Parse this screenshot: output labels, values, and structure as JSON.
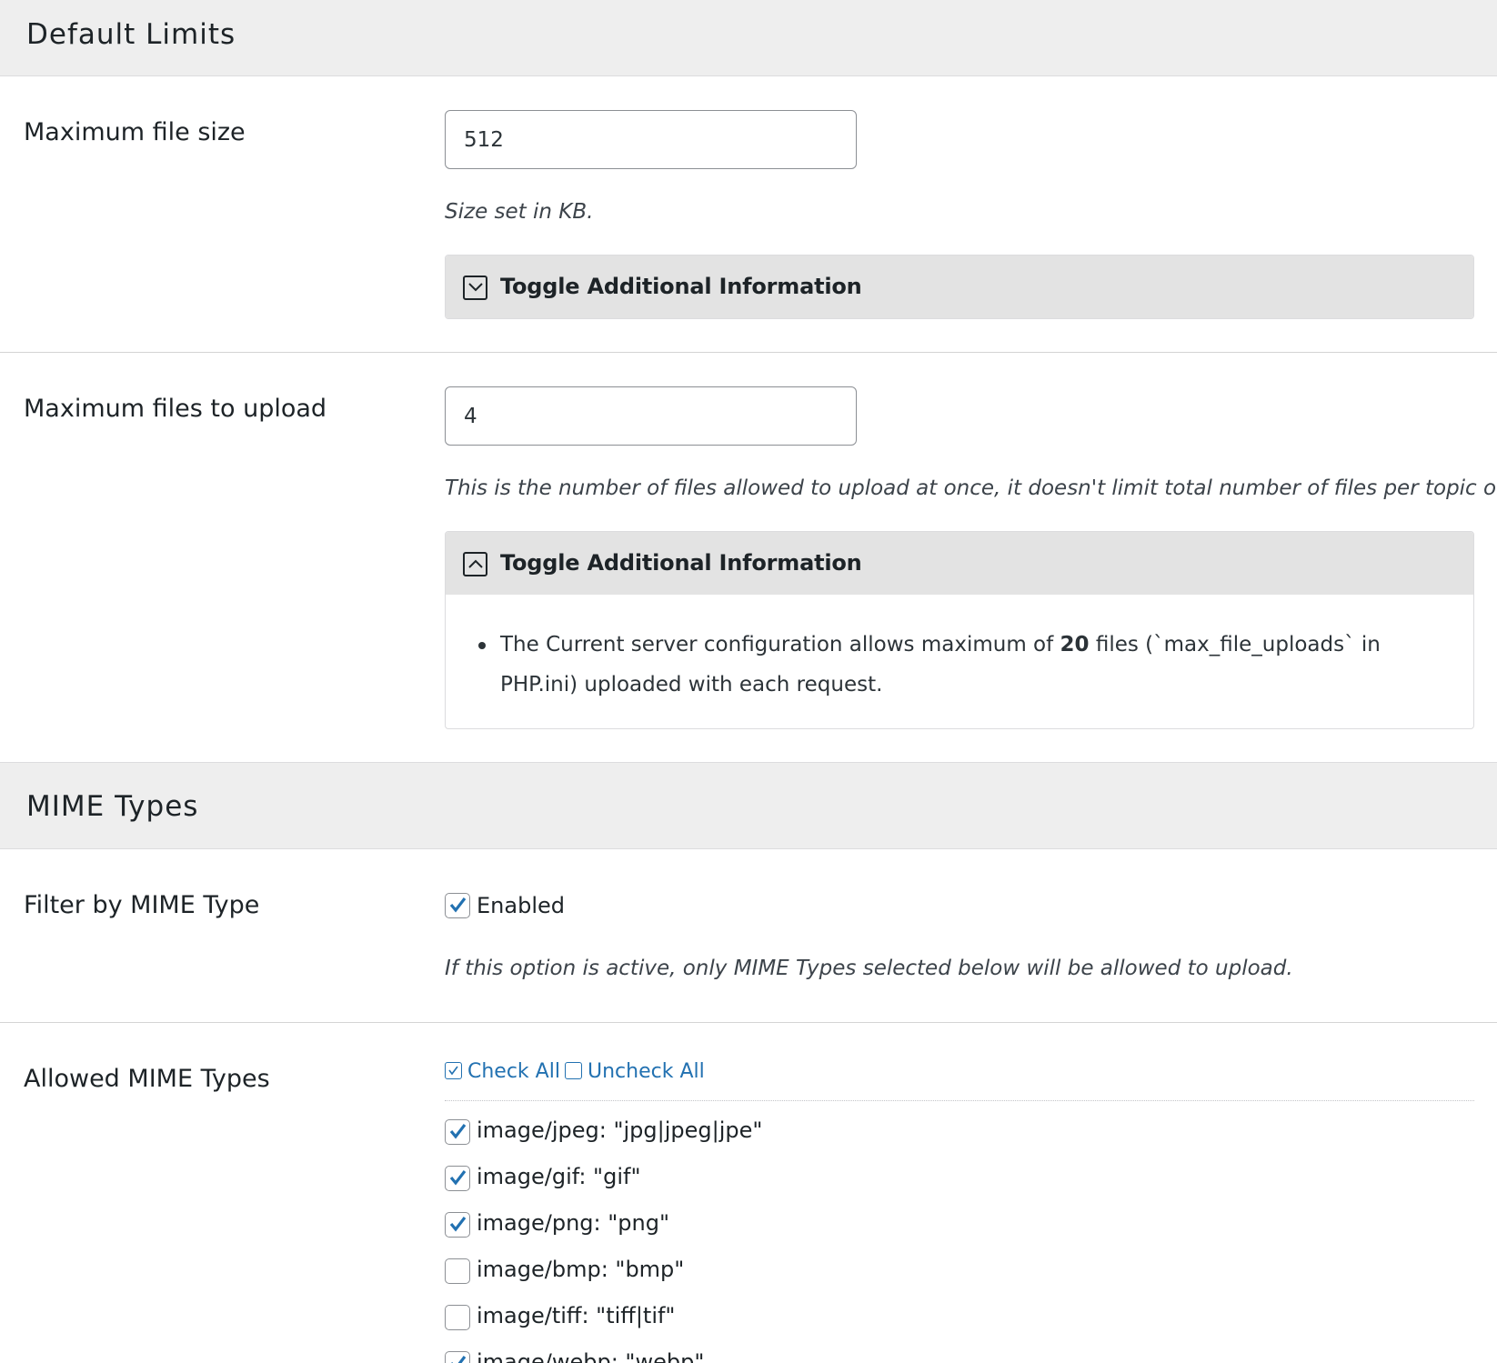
{
  "sections": {
    "default_limits_title": "Default Limits",
    "mime_types_title": "MIME Types"
  },
  "max_file_size": {
    "label": "Maximum file size",
    "value": "512",
    "description": "Size set in KB.",
    "toggle_label": "Toggle Additional Information",
    "toggle_state": "collapsed"
  },
  "max_files_upload": {
    "label": "Maximum files to upload",
    "value": "4",
    "description": "This is the number of files allowed to upload at once, it doesn't limit total number of files per topic or reply.",
    "toggle_label": "Toggle Additional Information",
    "toggle_state": "expanded",
    "info_prefix": "The Current server configuration allows maximum of ",
    "info_count": "20",
    "info_suffix": " files (`max_file_uploads` in PHP.ini) uploaded with each request."
  },
  "filter_mime": {
    "label": "Filter by MIME Type",
    "checkbox_label": "Enabled",
    "checked": true,
    "description": "If this option is active, only MIME Types selected below will be allowed to upload."
  },
  "allowed_mime": {
    "label": "Allowed MIME Types",
    "check_all": "Check All",
    "uncheck_all": "Uncheck All",
    "items": [
      {
        "label": "image/jpeg: \"jpg|jpeg|jpe\"",
        "checked": true
      },
      {
        "label": "image/gif: \"gif\"",
        "checked": true
      },
      {
        "label": "image/png: \"png\"",
        "checked": true
      },
      {
        "label": "image/bmp: \"bmp\"",
        "checked": false
      },
      {
        "label": "image/tiff: \"tiff|tif\"",
        "checked": false
      },
      {
        "label": "image/webp: \"webp\"",
        "checked": true
      }
    ]
  },
  "colors": {
    "check_accent": "#2271b1",
    "header_bg": "#eeeeee",
    "toggle_head_bg": "#e3e3e3"
  }
}
